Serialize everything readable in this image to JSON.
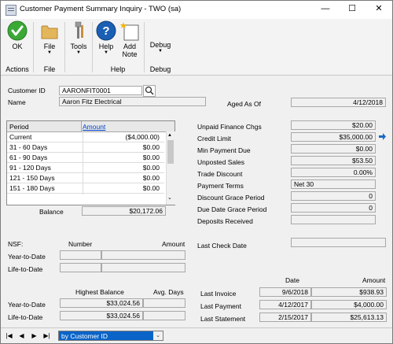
{
  "window": {
    "title": "Customer Payment Summary Inquiry  -  TWO (sa)",
    "minimize": "—",
    "maximize": "☐",
    "close": "✕"
  },
  "ribbon": {
    "ok_label": "OK",
    "file_label": "File",
    "tools_label": "Tools",
    "help_label": "Help",
    "addnote_label": "Add Note",
    "debug_label": "Debug",
    "groups": {
      "actions": "Actions",
      "file": "File",
      "help": "Help",
      "debug": "Debug"
    }
  },
  "customer": {
    "id_label": "Customer ID",
    "id_value": "AARONFIT0001",
    "name_label": "Name",
    "name_value": "Aaron Fitz Electrical",
    "aged_label": "Aged As Of",
    "aged_value": "4/12/2018"
  },
  "aging": {
    "header_period": "Period",
    "header_amount": "Amount",
    "rows": [
      {
        "period": "Current",
        "amount": "($4,000.00)"
      },
      {
        "period": "31 - 60 Days",
        "amount": "$0.00"
      },
      {
        "period": "61 - 90 Days",
        "amount": "$0.00"
      },
      {
        "period": "91 - 120 Days",
        "amount": "$0.00"
      },
      {
        "period": "121 - 150 Days",
        "amount": "$0.00"
      },
      {
        "period": "151 - 180 Days",
        "amount": "$0.00"
      }
    ],
    "balance_label": "Balance",
    "balance_value": "$20,172.06"
  },
  "summary": {
    "unpaid_finance_label": "Unpaid Finance Chgs",
    "unpaid_finance_value": "$20.00",
    "credit_limit_label": "Credit Limit",
    "credit_limit_value": "$35,000.00",
    "min_payment_label": "Min Payment Due",
    "min_payment_value": "$0.00",
    "unposted_label": "Unposted Sales",
    "unposted_value": "$53.50",
    "trade_discount_label": "Trade Discount",
    "trade_discount_value": "0.00%",
    "payment_terms_label": "Payment Terms",
    "payment_terms_value": "Net 30",
    "discount_grace_label": "Discount Grace Period",
    "discount_grace_value": "0",
    "due_date_grace_label": "Due Date Grace Period",
    "due_date_grace_value": "0",
    "deposits_label": "Deposits Received",
    "deposits_value": ""
  },
  "nsf": {
    "label": "NSF:",
    "number_header": "Number",
    "amount_header": "Amount",
    "ytd_label": "Year-to-Date",
    "ltd_label": "Life-to-Date",
    "last_check_label": "Last Check Date"
  },
  "balances": {
    "highest_header": "Highest Balance",
    "avg_days_header": "Avg. Days",
    "ytd_label": "Year-to-Date",
    "ytd_highest": "$33,024.56",
    "ltd_label": "Life-to-Date",
    "ltd_highest": "$33,024.56"
  },
  "last": {
    "date_header": "Date",
    "amount_header": "Amount",
    "invoice_label": "Last Invoice",
    "invoice_date": "9/6/2018",
    "invoice_amount": "$938.93",
    "payment_label": "Last Payment",
    "payment_date": "4/12/2017",
    "payment_amount": "$4,000.00",
    "statement_label": "Last Statement",
    "statement_date": "2/15/2017",
    "statement_amount": "$25,613.13"
  },
  "navigation": {
    "sort_value": "by Customer ID"
  },
  "colors": {
    "ok_green": "#3aa935",
    "help_blue": "#1a5fb4",
    "link_blue": "#0044cc",
    "selection_blue": "#0a64c8"
  }
}
